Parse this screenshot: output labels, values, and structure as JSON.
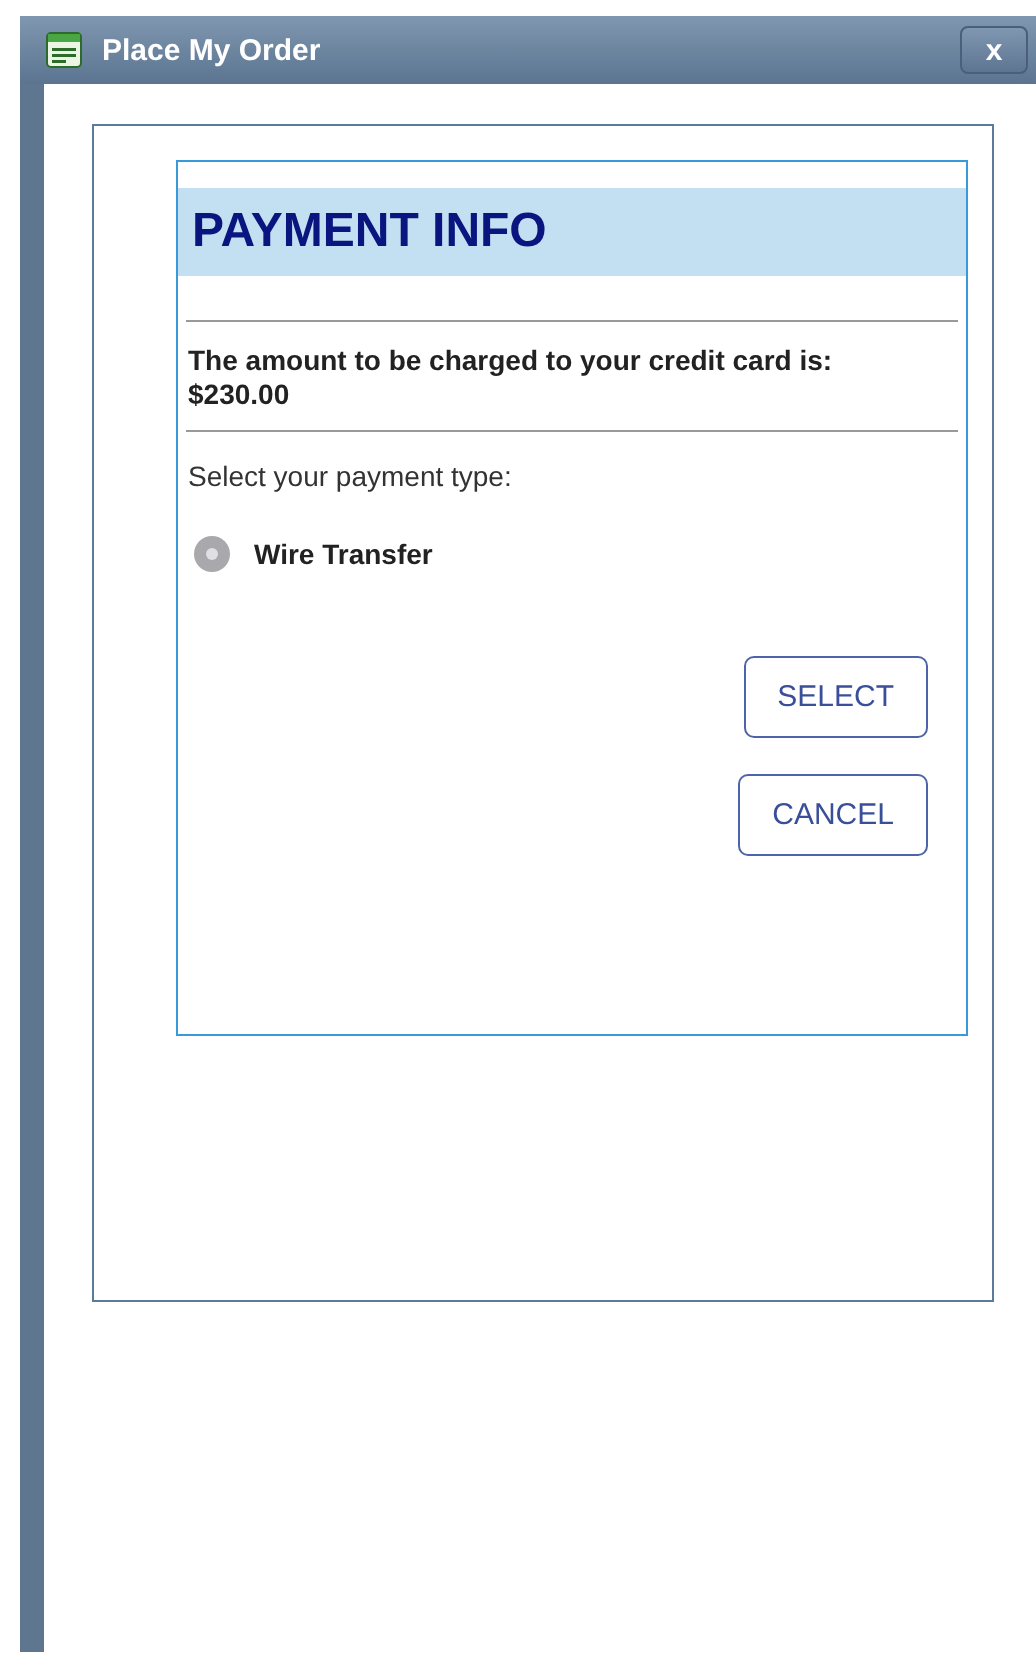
{
  "window": {
    "title": "Place My Order",
    "close_label": "x"
  },
  "payment": {
    "heading": "PAYMENT INFO",
    "amount_text": "The amount to be charged to your credit card is:",
    "amount": "$230.00",
    "prompt": "Select your payment type:",
    "options": [
      {
        "label": "Wire Transfer",
        "selected": false,
        "disabled": true
      }
    ],
    "buttons": [
      "SELECT",
      "CANCEL"
    ]
  }
}
